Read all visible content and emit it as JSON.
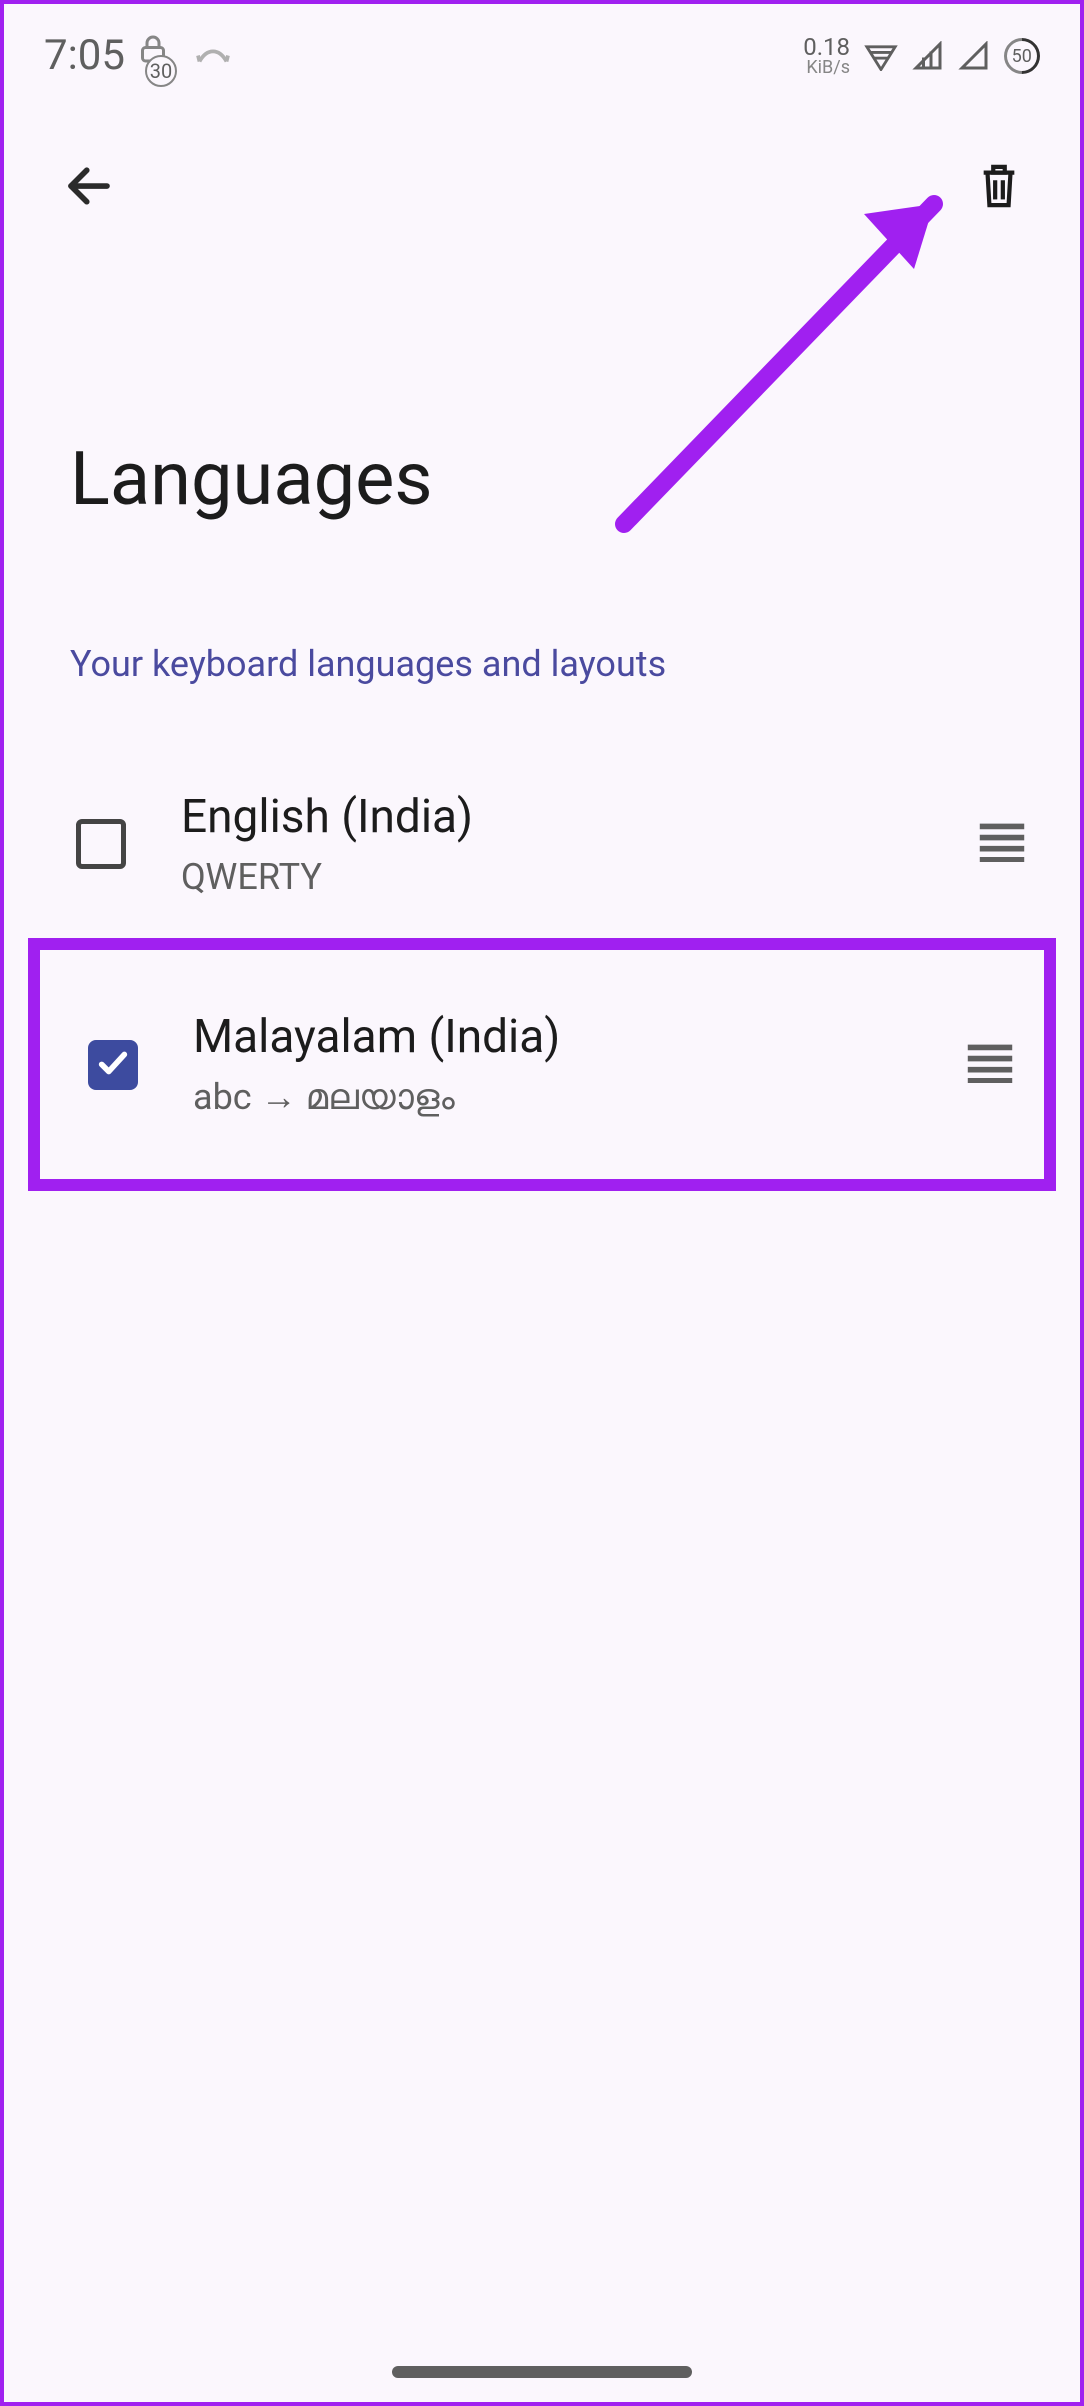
{
  "statusbar": {
    "time": "7:05",
    "badge_number": "30",
    "net_value": "0.18",
    "net_unit": "KiB/s",
    "battery": "50"
  },
  "toolbar": {},
  "page": {
    "title": "Languages",
    "section_label": "Your keyboard languages and layouts"
  },
  "languages": [
    {
      "title": "English (India)",
      "subtitle": "QWERTY",
      "checked": false
    },
    {
      "title": "Malayalam (India)",
      "subtitle": "abc → മലയാളം",
      "checked": true
    }
  ]
}
